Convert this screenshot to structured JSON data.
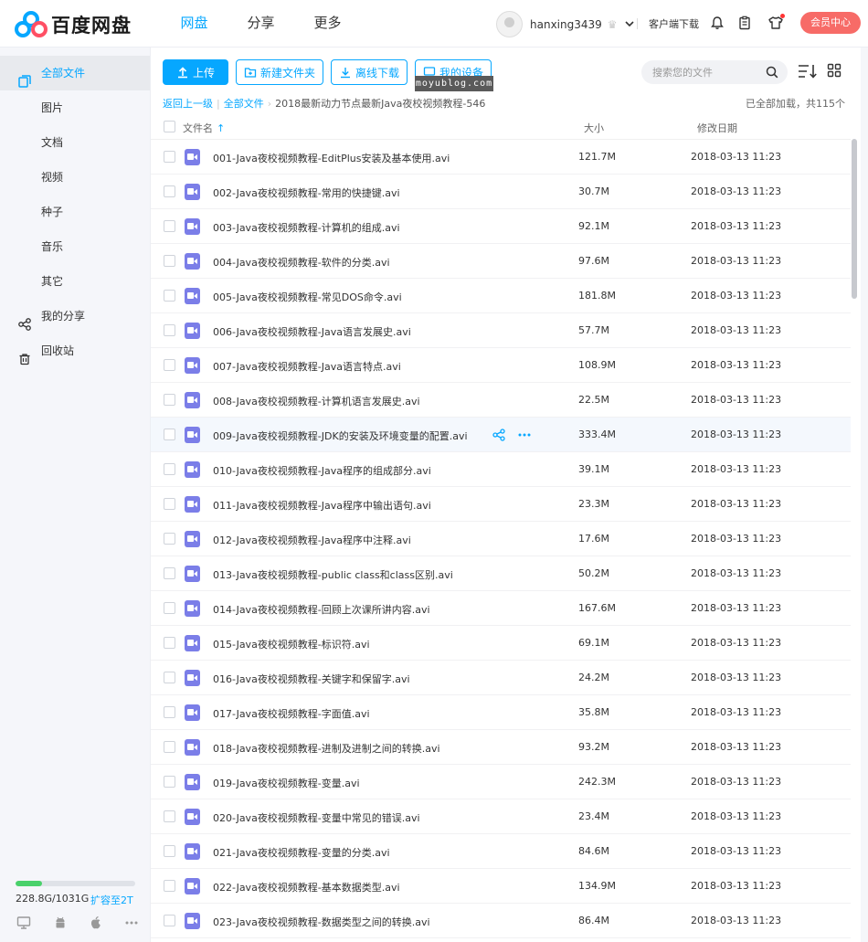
{
  "app": {
    "name": "百度网盘",
    "brand_color": "#06a7ff"
  },
  "nav": {
    "items": [
      {
        "label": "网盘",
        "active": true
      },
      {
        "label": "分享"
      },
      {
        "label": "更多"
      }
    ]
  },
  "user": {
    "name": "hanxing3439"
  },
  "header": {
    "client_download": "客户端下载",
    "vip_label": "会员中心"
  },
  "sidebar": {
    "items": [
      {
        "label": "全部文件",
        "active": true
      },
      {
        "label": "图片"
      },
      {
        "label": "文档"
      },
      {
        "label": "视频"
      },
      {
        "label": "种子"
      },
      {
        "label": "音乐"
      },
      {
        "label": "其它"
      },
      {
        "label": "我的分享"
      },
      {
        "label": "回收站"
      }
    ],
    "quota": {
      "text": "228.8G/1031G",
      "used_ratio": 0.222,
      "expand_label": "扩容至2T"
    }
  },
  "toolbar": {
    "upload": "上传",
    "new_folder": "新建文件夹",
    "offline_download": "离线下载",
    "my_devices": "我的设备"
  },
  "watermark": "moyublog.com",
  "search": {
    "placeholder": "搜索您的文件"
  },
  "breadcrumb": {
    "back": "返回上一级",
    "root": "全部文件",
    "current": "2018最新动力节点最新Java夜校视频教程-546"
  },
  "status": {
    "loaded": "已全部加载，共115个"
  },
  "table": {
    "headers": {
      "name": "文件名",
      "size": "大小",
      "date": "修改日期"
    },
    "rows": [
      {
        "name": "001-Java夜校视频教程-EditPlus安装及基本使用.avi",
        "size": "121.7M",
        "date": "2018-03-13 11:23"
      },
      {
        "name": "002-Java夜校视频教程-常用的快捷键.avi",
        "size": "30.7M",
        "date": "2018-03-13 11:23"
      },
      {
        "name": "003-Java夜校视频教程-计算机的组成.avi",
        "size": "92.1M",
        "date": "2018-03-13 11:23"
      },
      {
        "name": "004-Java夜校视频教程-软件的分类.avi",
        "size": "97.6M",
        "date": "2018-03-13 11:23"
      },
      {
        "name": "005-Java夜校视频教程-常见DOS命令.avi",
        "size": "181.8M",
        "date": "2018-03-13 11:23"
      },
      {
        "name": "006-Java夜校视频教程-Java语言发展史.avi",
        "size": "57.7M",
        "date": "2018-03-13 11:23"
      },
      {
        "name": "007-Java夜校视频教程-Java语言特点.avi",
        "size": "108.9M",
        "date": "2018-03-13 11:23"
      },
      {
        "name": "008-Java夜校视频教程-计算机语言发展史.avi",
        "size": "22.5M",
        "date": "2018-03-13 11:23"
      },
      {
        "name": "009-Java夜校视频教程-JDK的安装及环境变量的配置.avi",
        "size": "333.4M",
        "date": "2018-03-13 11:23",
        "hover": true
      },
      {
        "name": "010-Java夜校视频教程-Java程序的组成部分.avi",
        "size": "39.1M",
        "date": "2018-03-13 11:23"
      },
      {
        "name": "011-Java夜校视频教程-Java程序中输出语句.avi",
        "size": "23.3M",
        "date": "2018-03-13 11:23"
      },
      {
        "name": "012-Java夜校视频教程-Java程序中注释.avi",
        "size": "17.6M",
        "date": "2018-03-13 11:23"
      },
      {
        "name": "013-Java夜校视频教程-public class和class区别.avi",
        "size": "50.2M",
        "date": "2018-03-13 11:23"
      },
      {
        "name": "014-Java夜校视频教程-回顾上次课所讲内容.avi",
        "size": "167.6M",
        "date": "2018-03-13 11:23"
      },
      {
        "name": "015-Java夜校视频教程-标识符.avi",
        "size": "69.1M",
        "date": "2018-03-13 11:23"
      },
      {
        "name": "016-Java夜校视频教程-关键字和保留字.avi",
        "size": "24.2M",
        "date": "2018-03-13 11:23"
      },
      {
        "name": "017-Java夜校视频教程-字面值.avi",
        "size": "35.8M",
        "date": "2018-03-13 11:23"
      },
      {
        "name": "018-Java夜校视频教程-进制及进制之间的转换.avi",
        "size": "93.2M",
        "date": "2018-03-13 11:23"
      },
      {
        "name": "019-Java夜校视频教程-变量.avi",
        "size": "242.3M",
        "date": "2018-03-13 11:23"
      },
      {
        "name": "020-Java夜校视频教程-变量中常见的错误.avi",
        "size": "23.4M",
        "date": "2018-03-13 11:23"
      },
      {
        "name": "021-Java夜校视频教程-变量的分类.avi",
        "size": "84.6M",
        "date": "2018-03-13 11:23"
      },
      {
        "name": "022-Java夜校视频教程-基本数据类型.avi",
        "size": "134.9M",
        "date": "2018-03-13 11:23"
      },
      {
        "name": "023-Java夜校视频教程-数据类型之间的转换.avi",
        "size": "86.4M",
        "date": "2018-03-13 11:23"
      }
    ]
  },
  "icons": {
    "file_type": "video-file-icon",
    "row_actions": [
      "share-icon",
      "more-icon"
    ],
    "devices": [
      "desktop-icon",
      "android-icon",
      "apple-icon",
      "more-icon"
    ],
    "video_icon_color": "#7b7ee8"
  }
}
